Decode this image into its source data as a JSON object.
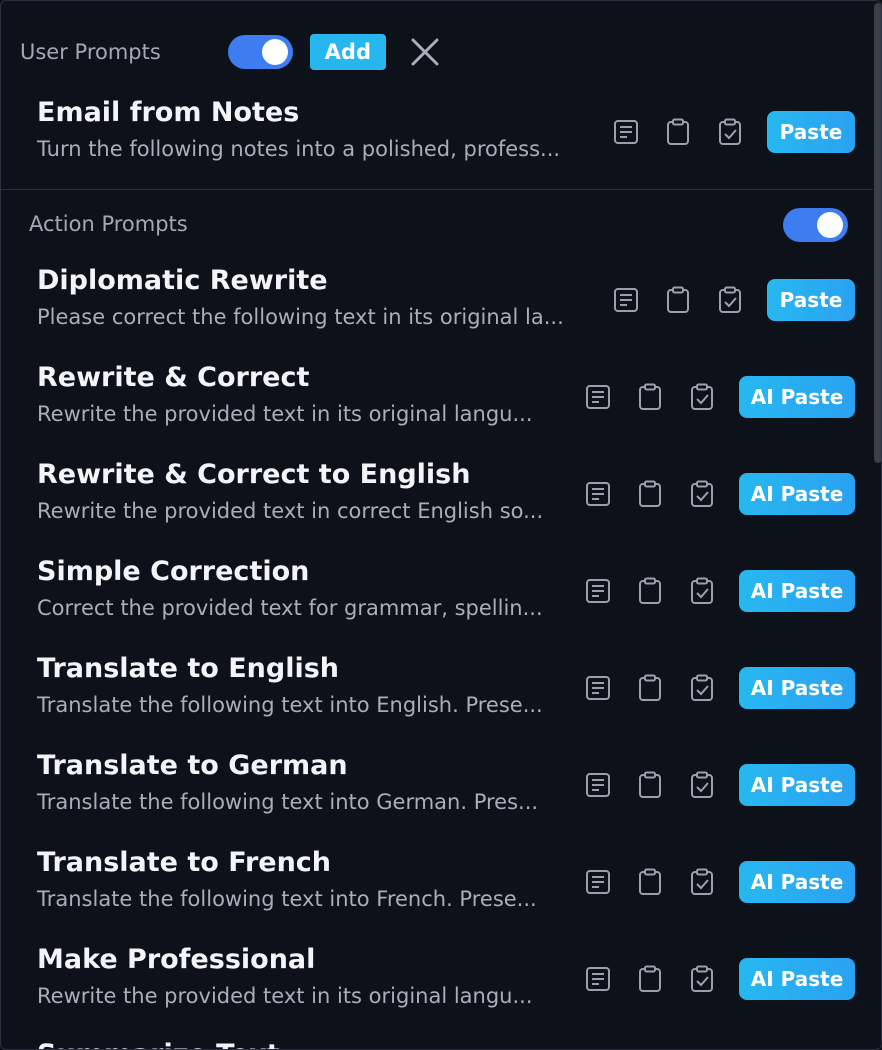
{
  "user_section": {
    "title": "User Prompts",
    "toggle_on": true,
    "add_label": "Add",
    "items": [
      {
        "title": "Email from Notes",
        "desc": "Turn the following notes into a polished, profess...",
        "paste_label": "Paste"
      }
    ]
  },
  "action_section": {
    "title": "Action Prompts",
    "toggle_on": true,
    "items": [
      {
        "title": "Diplomatic Rewrite",
        "desc": "Please correct the following text in its original la...",
        "paste_label": "Paste"
      },
      {
        "title": "Rewrite & Correct",
        "desc": "Rewrite the provided text in its original langu...",
        "paste_label": "AI Paste"
      },
      {
        "title": "Rewrite & Correct to English",
        "desc": "Rewrite the provided text in correct English so...",
        "paste_label": "AI Paste"
      },
      {
        "title": "Simple Correction",
        "desc": "Correct the provided text for grammar, spellin...",
        "paste_label": "AI Paste"
      },
      {
        "title": "Translate to English",
        "desc": "Translate the following text into English. Prese...",
        "paste_label": "AI Paste"
      },
      {
        "title": "Translate to German",
        "desc": "Translate the following text into German. Pres...",
        "paste_label": "AI Paste"
      },
      {
        "title": "Translate to French",
        "desc": "Translate the following text into French. Prese...",
        "paste_label": "AI Paste"
      },
      {
        "title": "Make Professional",
        "desc": "Rewrite the provided text in its original langu...",
        "paste_label": "AI Paste"
      }
    ],
    "partial_item_title": "Summarize Text"
  },
  "icons": {
    "details": "document-lines-icon",
    "copy": "clipboard-icon",
    "paste_check": "clipboard-check-icon",
    "close": "close-icon"
  },
  "colors": {
    "accent_toggle": "#3d7df0",
    "accent_button": "#27b7ef",
    "background": "#0d111a"
  }
}
